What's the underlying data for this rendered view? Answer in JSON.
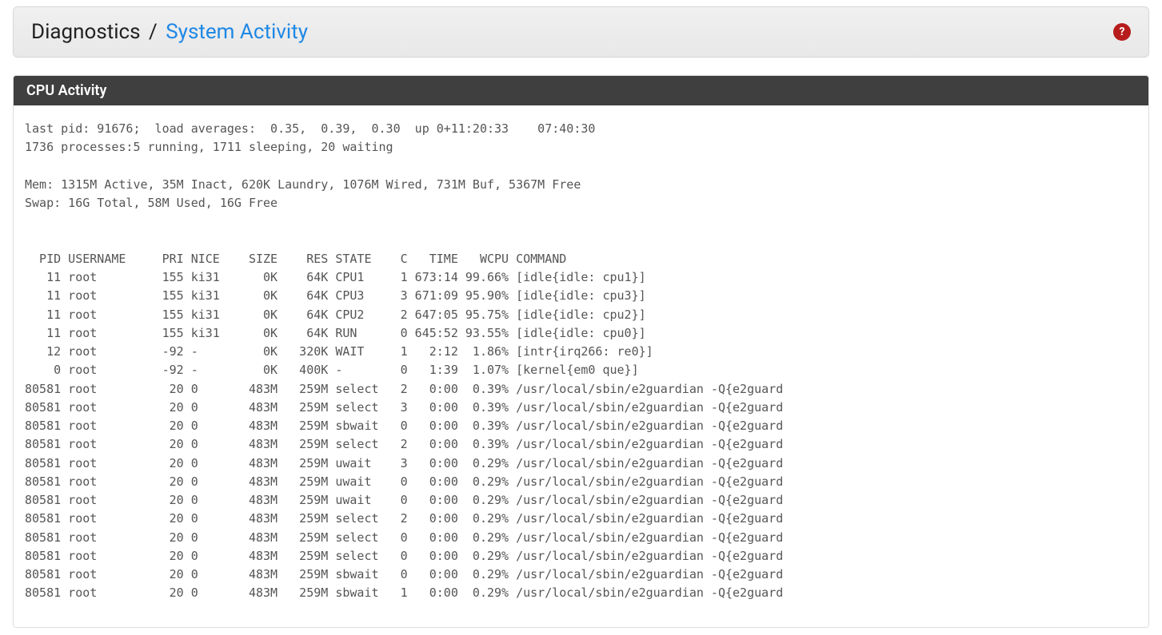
{
  "breadcrumb": {
    "first": "Diagnostics",
    "sep": "/",
    "current": "System Activity"
  },
  "help_icon_glyph": "?",
  "panel": {
    "title": "CPU Activity"
  },
  "summary": {
    "line1": "last pid: 91676;  load averages:  0.35,  0.39,  0.30  up 0+11:20:33    07:40:30",
    "line2": "1736 processes:5 running, 1711 sleeping, 20 waiting",
    "line3": "Mem: 1315M Active, 35M Inact, 620K Laundry, 1076M Wired, 731M Buf, 5367M Free",
    "line4": "Swap: 16G Total, 58M Used, 16G Free"
  },
  "columns": [
    "PID",
    "USERNAME",
    "PRI",
    "NICE",
    "SIZE",
    "RES",
    "STATE",
    "C",
    "TIME",
    "WCPU",
    "COMMAND"
  ],
  "rows": [
    {
      "pid": "11",
      "user": "root",
      "pri": "155",
      "nice": "ki31",
      "size": "0K",
      "res": "64K",
      "state": "CPU1",
      "c": "1",
      "time": "673:14",
      "wcpu": "99.66%",
      "cmd": "[idle{idle: cpu1}]"
    },
    {
      "pid": "11",
      "user": "root",
      "pri": "155",
      "nice": "ki31",
      "size": "0K",
      "res": "64K",
      "state": "CPU3",
      "c": "3",
      "time": "671:09",
      "wcpu": "95.90%",
      "cmd": "[idle{idle: cpu3}]"
    },
    {
      "pid": "11",
      "user": "root",
      "pri": "155",
      "nice": "ki31",
      "size": "0K",
      "res": "64K",
      "state": "CPU2",
      "c": "2",
      "time": "647:05",
      "wcpu": "95.75%",
      "cmd": "[idle{idle: cpu2}]"
    },
    {
      "pid": "11",
      "user": "root",
      "pri": "155",
      "nice": "ki31",
      "size": "0K",
      "res": "64K",
      "state": "RUN",
      "c": "0",
      "time": "645:52",
      "wcpu": "93.55%",
      "cmd": "[idle{idle: cpu0}]"
    },
    {
      "pid": "12",
      "user": "root",
      "pri": "-92",
      "nice": "-",
      "size": "0K",
      "res": "320K",
      "state": "WAIT",
      "c": "1",
      "time": "2:12",
      "wcpu": "1.86%",
      "cmd": "[intr{irq266: re0}]"
    },
    {
      "pid": "0",
      "user": "root",
      "pri": "-92",
      "nice": "-",
      "size": "0K",
      "res": "400K",
      "state": "-",
      "c": "0",
      "time": "1:39",
      "wcpu": "1.07%",
      "cmd": "[kernel{em0 que}]"
    },
    {
      "pid": "80581",
      "user": "root",
      "pri": "20",
      "nice": "0",
      "size": "483M",
      "res": "259M",
      "state": "select",
      "c": "2",
      "time": "0:00",
      "wcpu": "0.39%",
      "cmd": "/usr/local/sbin/e2guardian -Q{e2guard"
    },
    {
      "pid": "80581",
      "user": "root",
      "pri": "20",
      "nice": "0",
      "size": "483M",
      "res": "259M",
      "state": "select",
      "c": "3",
      "time": "0:00",
      "wcpu": "0.39%",
      "cmd": "/usr/local/sbin/e2guardian -Q{e2guard"
    },
    {
      "pid": "80581",
      "user": "root",
      "pri": "20",
      "nice": "0",
      "size": "483M",
      "res": "259M",
      "state": "sbwait",
      "c": "0",
      "time": "0:00",
      "wcpu": "0.39%",
      "cmd": "/usr/local/sbin/e2guardian -Q{e2guard"
    },
    {
      "pid": "80581",
      "user": "root",
      "pri": "20",
      "nice": "0",
      "size": "483M",
      "res": "259M",
      "state": "select",
      "c": "2",
      "time": "0:00",
      "wcpu": "0.39%",
      "cmd": "/usr/local/sbin/e2guardian -Q{e2guard"
    },
    {
      "pid": "80581",
      "user": "root",
      "pri": "20",
      "nice": "0",
      "size": "483M",
      "res": "259M",
      "state": "uwait",
      "c": "3",
      "time": "0:00",
      "wcpu": "0.29%",
      "cmd": "/usr/local/sbin/e2guardian -Q{e2guard"
    },
    {
      "pid": "80581",
      "user": "root",
      "pri": "20",
      "nice": "0",
      "size": "483M",
      "res": "259M",
      "state": "uwait",
      "c": "0",
      "time": "0:00",
      "wcpu": "0.29%",
      "cmd": "/usr/local/sbin/e2guardian -Q{e2guard"
    },
    {
      "pid": "80581",
      "user": "root",
      "pri": "20",
      "nice": "0",
      "size": "483M",
      "res": "259M",
      "state": "uwait",
      "c": "0",
      "time": "0:00",
      "wcpu": "0.29%",
      "cmd": "/usr/local/sbin/e2guardian -Q{e2guard"
    },
    {
      "pid": "80581",
      "user": "root",
      "pri": "20",
      "nice": "0",
      "size": "483M",
      "res": "259M",
      "state": "select",
      "c": "2",
      "time": "0:00",
      "wcpu": "0.29%",
      "cmd": "/usr/local/sbin/e2guardian -Q{e2guard"
    },
    {
      "pid": "80581",
      "user": "root",
      "pri": "20",
      "nice": "0",
      "size": "483M",
      "res": "259M",
      "state": "select",
      "c": "0",
      "time": "0:00",
      "wcpu": "0.29%",
      "cmd": "/usr/local/sbin/e2guardian -Q{e2guard"
    },
    {
      "pid": "80581",
      "user": "root",
      "pri": "20",
      "nice": "0",
      "size": "483M",
      "res": "259M",
      "state": "select",
      "c": "0",
      "time": "0:00",
      "wcpu": "0.29%",
      "cmd": "/usr/local/sbin/e2guardian -Q{e2guard"
    },
    {
      "pid": "80581",
      "user": "root",
      "pri": "20",
      "nice": "0",
      "size": "483M",
      "res": "259M",
      "state": "sbwait",
      "c": "0",
      "time": "0:00",
      "wcpu": "0.29%",
      "cmd": "/usr/local/sbin/e2guardian -Q{e2guard"
    },
    {
      "pid": "80581",
      "user": "root",
      "pri": "20",
      "nice": "0",
      "size": "483M",
      "res": "259M",
      "state": "sbwait",
      "c": "1",
      "time": "0:00",
      "wcpu": "0.29%",
      "cmd": "/usr/local/sbin/e2guardian -Q{e2guard"
    }
  ],
  "widths": {
    "pid": 5,
    "user": 9,
    "pri": 7,
    "nice": 5,
    "size": 7,
    "res": 7,
    "state": 7,
    "c": 3,
    "time": 7,
    "wcpu": 7
  }
}
